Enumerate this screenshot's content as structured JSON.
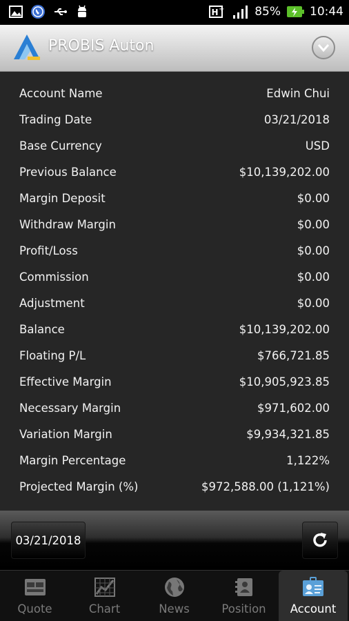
{
  "status_bar": {
    "battery": "85%",
    "time": "10:44",
    "icons": [
      "image-icon",
      "phone-call-icon",
      "usb-icon",
      "android-icon",
      "network-h-plus-icon",
      "signal-icon",
      "battery-charging-icon"
    ]
  },
  "header": {
    "app_title": "PROBIS Auton",
    "logo_icon": "probis-logo-icon",
    "menu_icon": "dropdown-circle-icon"
  },
  "account": {
    "rows": [
      {
        "label": "Account Name",
        "value": "Edwin Chui"
      },
      {
        "label": "Trading Date",
        "value": "03/21/2018"
      },
      {
        "label": "Base Currency",
        "value": "USD"
      },
      {
        "label": "Previous Balance",
        "value": "$10,139,202.00"
      },
      {
        "label": "Margin Deposit",
        "value": "$0.00"
      },
      {
        "label": "Withdraw Margin",
        "value": "$0.00"
      },
      {
        "label": "Profit/Loss",
        "value": "$0.00"
      },
      {
        "label": "Commission",
        "value": "$0.00"
      },
      {
        "label": "Adjustment",
        "value": "$0.00"
      },
      {
        "label": "Balance",
        "value": "$10,139,202.00"
      },
      {
        "label": "Floating P/L",
        "value": "$766,721.85"
      },
      {
        "label": "Effective Margin",
        "value": "$10,905,923.85"
      },
      {
        "label": "Necessary Margin",
        "value": "$971,602.00"
      },
      {
        "label": "Variation Margin",
        "value": "$9,934,321.85"
      },
      {
        "label": "Margin Percentage",
        "value": "1,122%"
      },
      {
        "label": "Projected Margin (%)",
        "value": "$972,588.00 (1,121%)"
      }
    ]
  },
  "toolbar": {
    "date_button": "03/21/2018",
    "refresh_icon": "refresh-icon"
  },
  "tabs": [
    {
      "label": "Quote",
      "icon": "quote-icon",
      "active": false
    },
    {
      "label": "Chart",
      "icon": "chart-icon",
      "active": false
    },
    {
      "label": "News",
      "icon": "globe-icon",
      "active": false
    },
    {
      "label": "Position",
      "icon": "position-icon",
      "active": false
    },
    {
      "label": "Account",
      "icon": "account-icon",
      "active": true
    }
  ],
  "colors": {
    "content_bg": "#262626",
    "active_tab_icon": "#5aa0d8"
  }
}
